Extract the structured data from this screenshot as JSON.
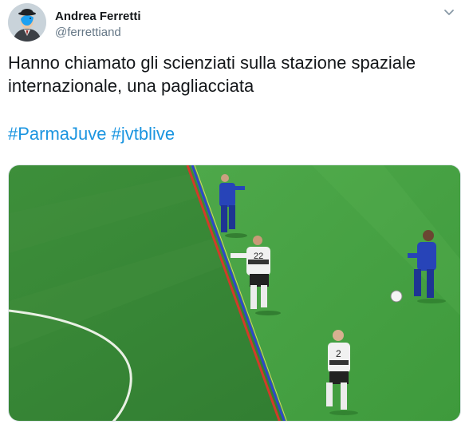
{
  "author": {
    "display_name": "Andrea Ferretti",
    "handle": "@ferrettiand",
    "avatar_icon": "bowler-hat-man-avatar"
  },
  "menu_icon": "chevron-down-icon",
  "tweet": {
    "text_line_1": "Hanno chiamato gli scienziati sulla stazione spaziale",
    "text_line_2": "internazionale, una pagliacciata",
    "hashtags": [
      "#ParmaJuve",
      "#jvtblive"
    ]
  },
  "media": {
    "description_icon": "soccer-offside-var-image",
    "jersey_numbers": [
      "22",
      "2"
    ]
  },
  "colors": {
    "hashtag": "#1b95e0",
    "text": "#14171a",
    "secondary": "#657786",
    "pitch": "#3a8a36",
    "offside_line_blue": "#2f46c9",
    "offside_line_red": "#d33a2a"
  }
}
